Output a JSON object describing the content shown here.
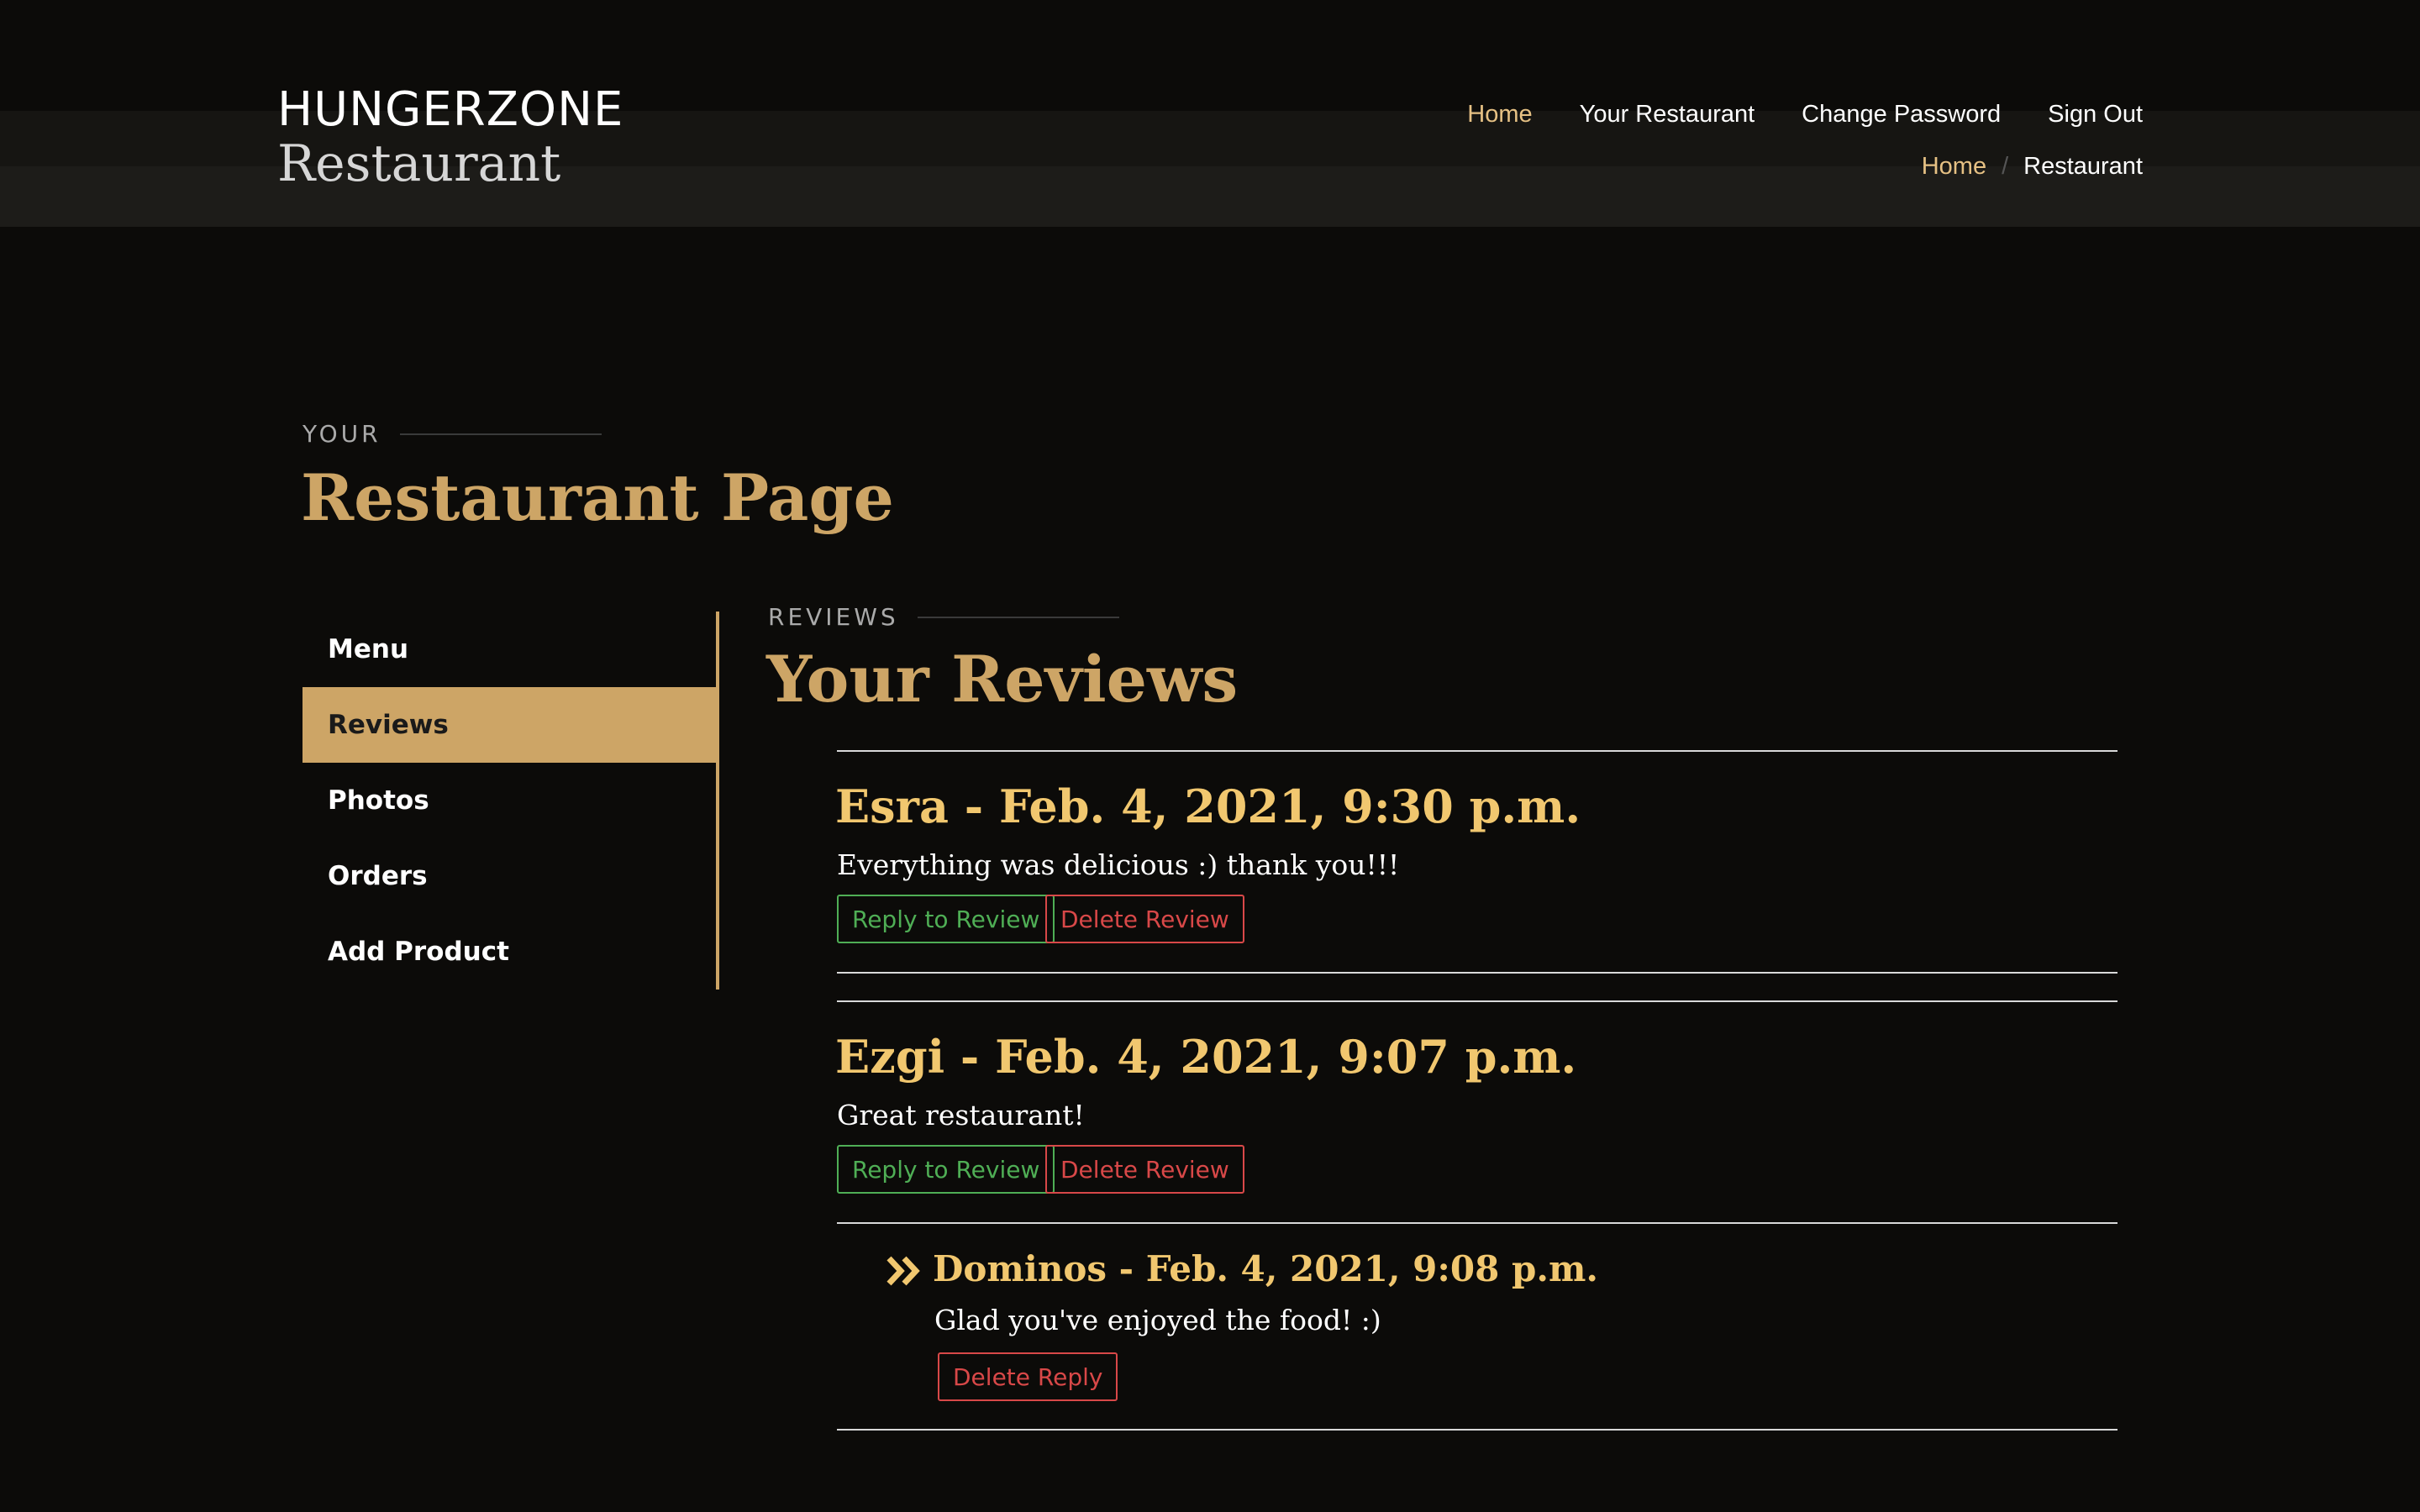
{
  "header": {
    "logo_title": "HUNGERZONE",
    "logo_subtitle": "Restaurant",
    "nav": [
      {
        "label": "Home",
        "active": true
      },
      {
        "label": "Your Restaurant",
        "active": false
      },
      {
        "label": "Change Password",
        "active": false
      },
      {
        "label": "Sign Out",
        "active": false
      }
    ]
  },
  "breadcrumb": {
    "home": "Home",
    "separator": "/",
    "current": "Restaurant"
  },
  "page": {
    "kicker": "YOUR",
    "title": "Restaurant Page"
  },
  "sidebar": {
    "items": [
      {
        "label": "Menu",
        "active": false
      },
      {
        "label": "Reviews",
        "active": true
      },
      {
        "label": "Photos",
        "active": false
      },
      {
        "label": "Orders",
        "active": false
      },
      {
        "label": "Add Product",
        "active": false
      }
    ]
  },
  "reviews_section": {
    "kicker": "REVIEWS",
    "title": "Your Reviews",
    "reviews": [
      {
        "heading": "Esra - Feb. 4, 2021, 9:30 p.m.",
        "text": "Everything was delicious :) thank you!!!",
        "reply_button": "Reply to Review",
        "delete_button": "Delete Review"
      },
      {
        "heading": "Ezgi - Feb. 4, 2021, 9:07 p.m.",
        "text": "Great restaurant!",
        "reply_button": "Reply to Review",
        "delete_button": "Delete Review",
        "reply": {
          "icon": "double-chevron-right-icon",
          "heading": "Dominos - Feb. 4, 2021, 9:08 p.m.",
          "text": "Glad you've enjoyed the food! :)",
          "delete_button": "Delete Reply"
        }
      }
    ]
  },
  "colors": {
    "background": "#0c0b09",
    "accent": "#cda566",
    "heading_gold": "#f1c76f",
    "success": "#4fae55",
    "danger": "#d84848"
  }
}
